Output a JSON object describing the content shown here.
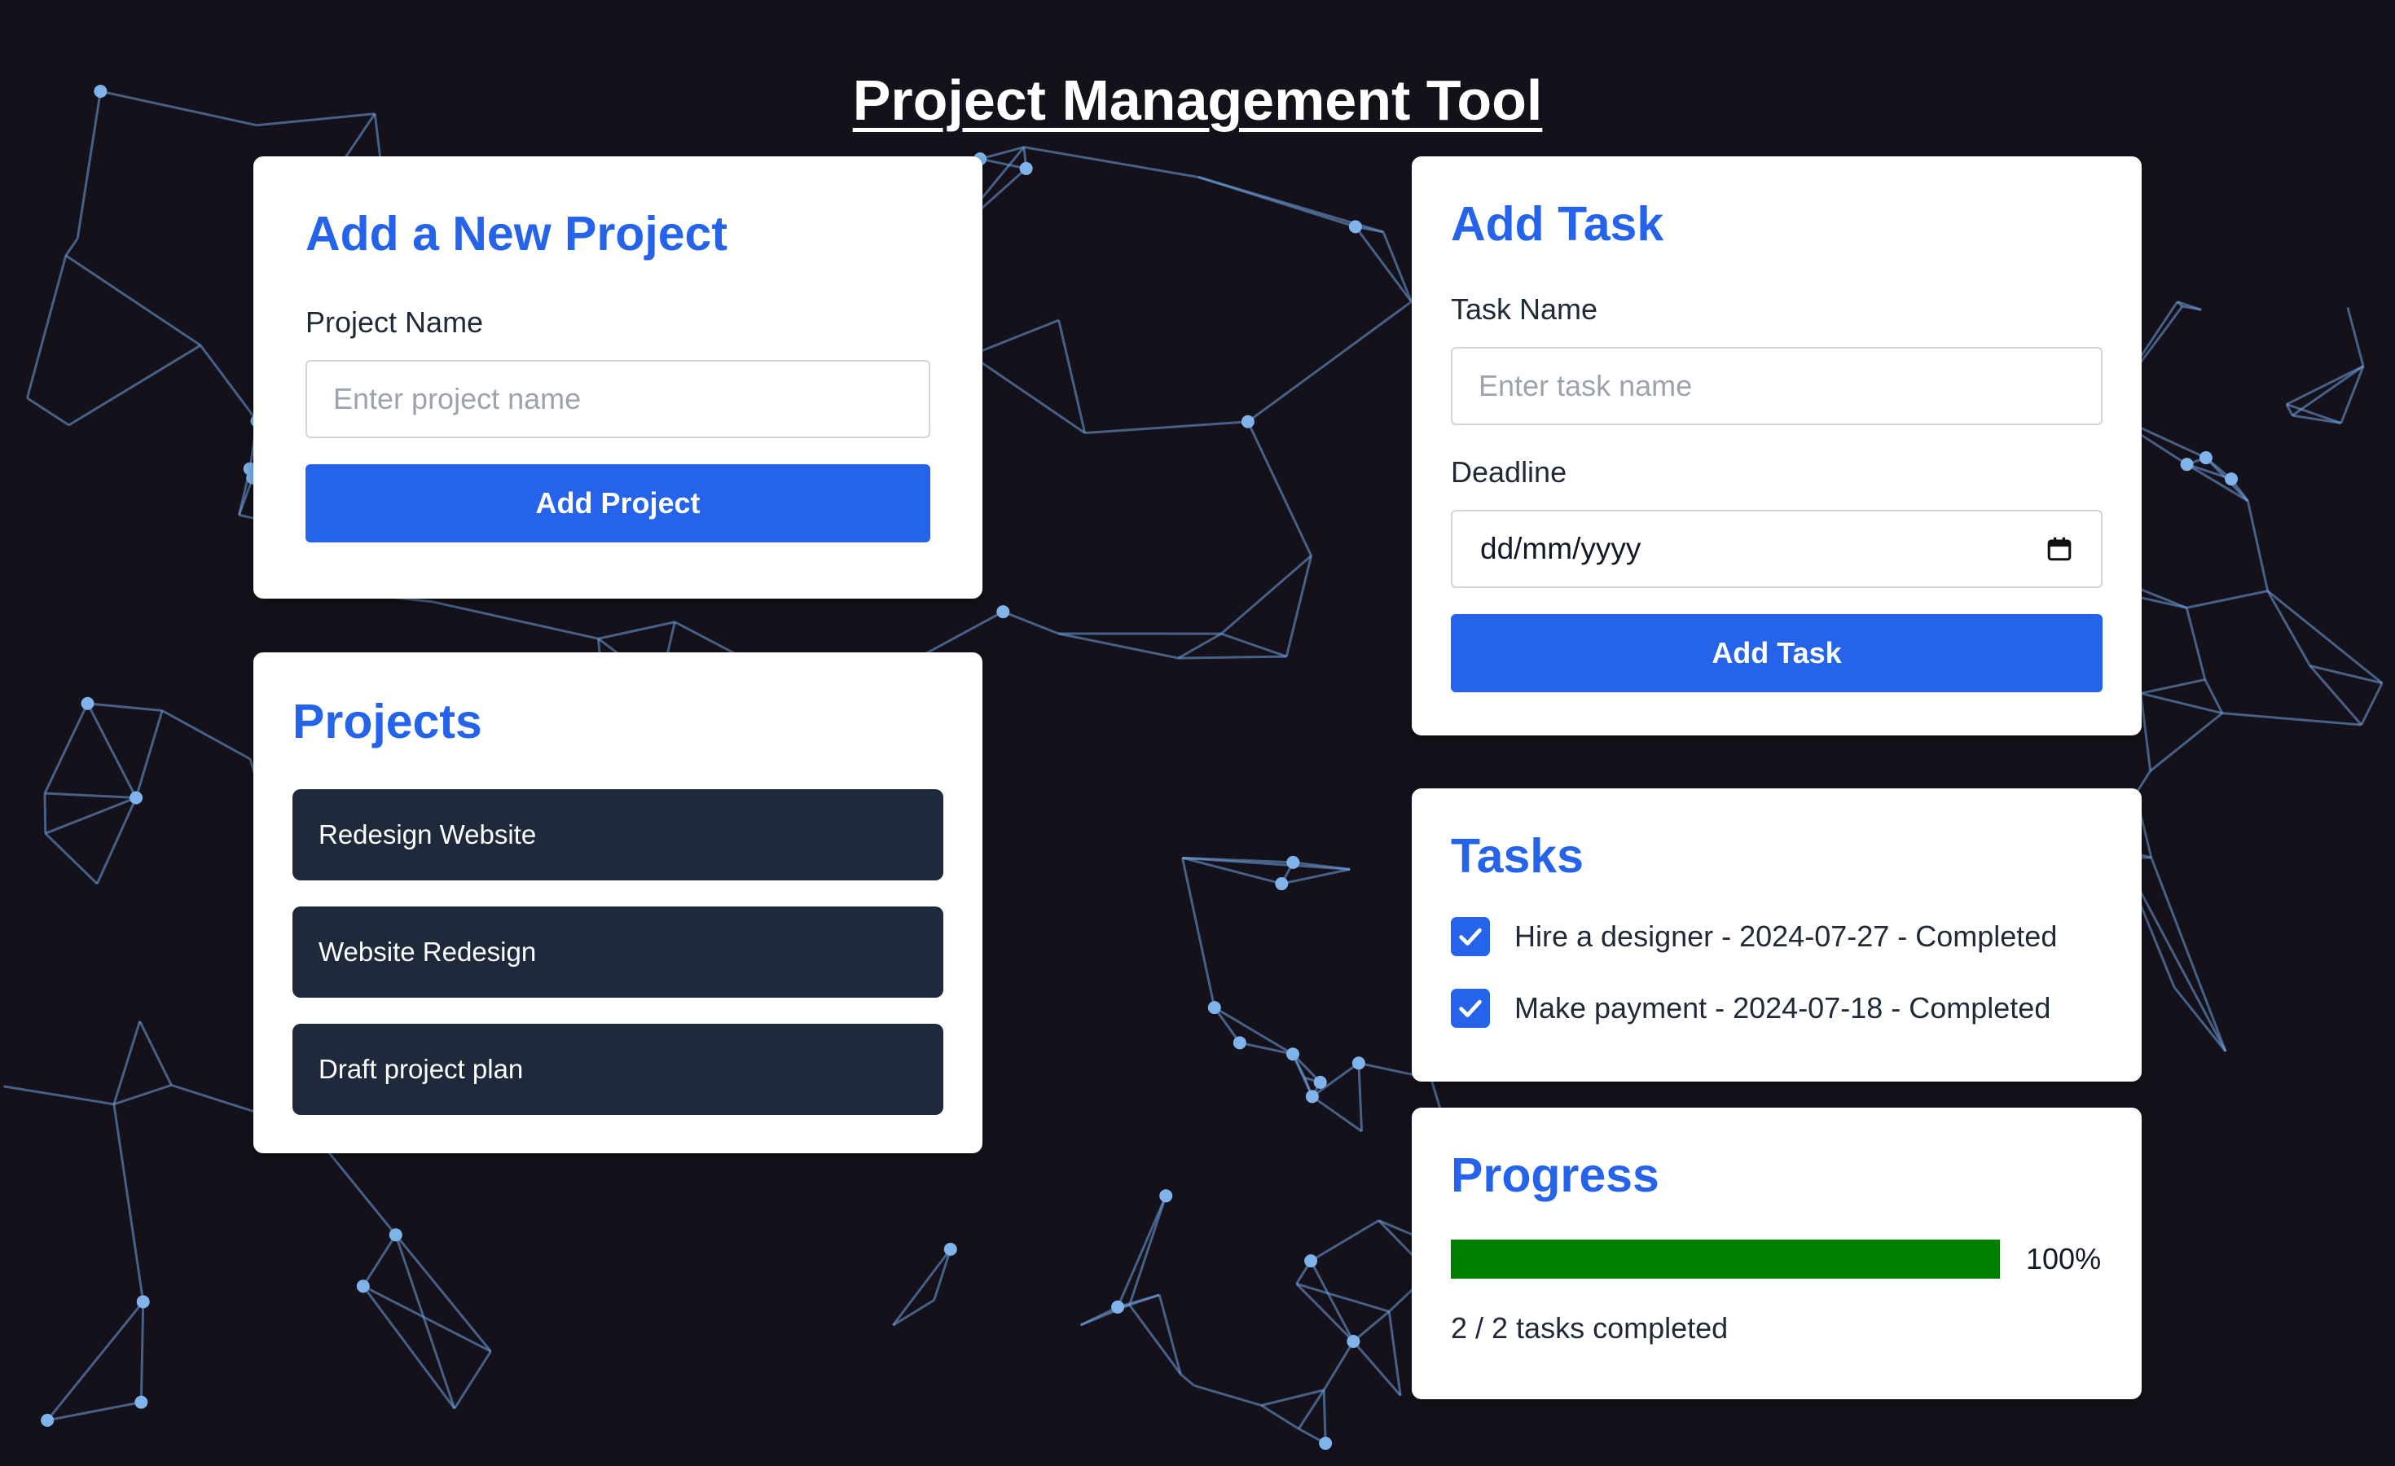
{
  "page": {
    "title": "Project Management Tool"
  },
  "add_project": {
    "heading": "Add a New Project",
    "label": "Project Name",
    "placeholder": "Enter project name",
    "button": "Add Project"
  },
  "projects": {
    "heading": "Projects",
    "items": [
      "Redesign Website",
      "Website Redesign",
      "Draft project plan"
    ]
  },
  "add_task": {
    "heading": "Add Task",
    "name_label": "Task Name",
    "name_placeholder": "Enter task name",
    "deadline_label": "Deadline",
    "deadline_value": "dd/mm/yyyy",
    "button": "Add Task"
  },
  "tasks": {
    "heading": "Tasks",
    "items": [
      {
        "text": "Hire a designer - 2024-07-27 - Completed",
        "checked": true
      },
      {
        "text": "Make payment - 2024-07-18 - Completed",
        "checked": true
      }
    ]
  },
  "progress": {
    "heading": "Progress",
    "percent_label": "100%",
    "fraction": 1.0,
    "summary": "2 / 2 tasks completed"
  },
  "colors": {
    "background": "#14111a",
    "accent": "#2563eb",
    "project_item": "#1e293b",
    "progress_fill": "#008000",
    "network_lines": "#6fa3e0"
  },
  "icons": [
    "calendar-icon",
    "checkmark-icon"
  ]
}
